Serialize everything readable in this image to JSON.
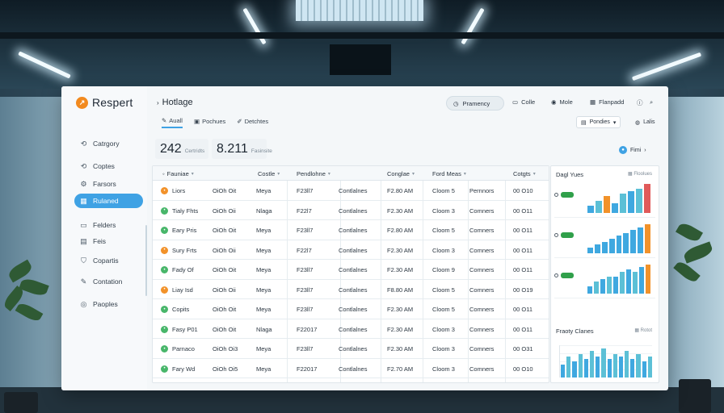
{
  "app": {
    "name": "Respert",
    "breadcrumb": "Hotlage",
    "status_pill": "Pramency",
    "top_buttons": [
      {
        "label": "Colle",
        "icon": "folder-icon"
      },
      {
        "label": "Mole",
        "icon": "circle-icon"
      },
      {
        "label": "Flanpadd",
        "icon": "calendar-icon"
      }
    ],
    "help_icon": "help-icon",
    "search_icon": "search-icon"
  },
  "sidebar": {
    "items": [
      {
        "label": "Catrgory",
        "icon": "refresh-icon",
        "active": false
      },
      {
        "label": "Coptes",
        "icon": "refresh-icon",
        "active": false
      },
      {
        "label": "Farsors",
        "icon": "gear-icon",
        "active": false
      },
      {
        "label": "Rulaned",
        "icon": "grid-icon",
        "active": true
      },
      {
        "label": "Felders",
        "icon": "folder-icon",
        "active": false
      },
      {
        "label": "Feis",
        "icon": "document-icon",
        "active": false
      },
      {
        "label": "Copartis",
        "icon": "filter-icon",
        "active": false
      },
      {
        "label": "Contation",
        "icon": "pen-icon",
        "active": false
      },
      {
        "label": "Paoples",
        "icon": "settings-icon",
        "active": false
      }
    ]
  },
  "tabs": [
    {
      "label": "Auall",
      "icon": "pen-icon",
      "active": true
    },
    {
      "label": "Pochues",
      "icon": "card-icon",
      "active": false
    },
    {
      "label": "Detchtes",
      "icon": "edit-icon",
      "active": false
    }
  ],
  "controls": {
    "filter_label": "Pondies",
    "sort_label": "Lalis",
    "share_label": "Fimi"
  },
  "stats": [
    {
      "value": "242",
      "label": "Certridts"
    },
    {
      "value": "8.211",
      "label": "Fasinsite"
    }
  ],
  "table": {
    "headers": [
      "Fauniae",
      "Costle",
      "Pendlohne",
      "Conglae",
      "Ford Meas",
      "Cotgts"
    ],
    "rows": [
      {
        "status": "orange",
        "name": "Liors",
        "date": "OiOh Oit",
        "type": "Meya",
        "code": "F23ll7",
        "kind": "Contlalnes",
        "time": "F2.80 AM",
        "group": "Cloom 5",
        "category": "Pernnors",
        "num": "00 O10"
      },
      {
        "status": "green",
        "name": "Tialy Fhts",
        "date": "OiOh Oii",
        "type": "Nlaga",
        "code": "F22l7",
        "kind": "Contlalnes",
        "time": "F2.30 AM",
        "group": "Cloom 3",
        "category": "Comners",
        "num": "00 O11"
      },
      {
        "status": "green",
        "name": "Eary Pris",
        "date": "OiOh Oit",
        "type": "Meya",
        "code": "F23ll7",
        "kind": "Contlalnes",
        "time": "F2.80 AM",
        "group": "Cloom 5",
        "category": "Comners",
        "num": "00 O11"
      },
      {
        "status": "orange",
        "name": "Sury Frts",
        "date": "OiOh Oii",
        "type": "Meya",
        "code": "F22l7",
        "kind": "Contlalnes",
        "time": "F2.30 AM",
        "group": "Cloom 3",
        "category": "Comners",
        "num": "00 O11"
      },
      {
        "status": "green",
        "name": "Fady Of",
        "date": "OiOh Oit",
        "type": "Meya",
        "code": "F23ll7",
        "kind": "Contlalnes",
        "time": "F2.30 AM",
        "group": "Cloom 9",
        "category": "Comners",
        "num": "00 O11"
      },
      {
        "status": "orange",
        "name": "Liay Isd",
        "date": "OiOh Oii",
        "type": "Meya",
        "code": "F23ll7",
        "kind": "Contlalnes",
        "time": "F8.80 AM",
        "group": "Cloom 5",
        "category": "Comners",
        "num": "00 O19"
      },
      {
        "status": "green",
        "name": "Copits",
        "date": "OiOh Oit",
        "type": "Meya",
        "code": "F23ll7",
        "kind": "Contlalnes",
        "time": "F2.30 AM",
        "group": "Cloom 5",
        "category": "Comners",
        "num": "00 O11"
      },
      {
        "status": "green",
        "name": "Fasy P01",
        "date": "OiOh Oit",
        "type": "Nlaga",
        "code": "F22017",
        "kind": "Contlalnes",
        "time": "F2.30 AM",
        "group": "Cloom 3",
        "category": "Comners",
        "num": "00 O11"
      },
      {
        "status": "green",
        "name": "Parnaco",
        "date": "OiOh Oi3",
        "type": "Meya",
        "code": "F23ll7",
        "kind": "Contlalnes",
        "time": "F2.30 AM",
        "group": "Cloom 3",
        "category": "Comners",
        "num": "00 O31"
      },
      {
        "status": "green",
        "name": "Fary Wd",
        "date": "OiOh Oi5",
        "type": "Meya",
        "code": "F22017",
        "kind": "Contlalnes",
        "time": "F2.70 AM",
        "group": "Cloom 3",
        "category": "Comners",
        "num": "00 O10"
      }
    ]
  },
  "side_panel": {
    "title": "Dagl Yues",
    "control": "Floolues",
    "badge_color": "#30a04a",
    "trend_title": "Fraoty Clanes",
    "trend_control": "Rotot",
    "colors": {
      "blue": "#3fa8e0",
      "teal": "#5cc0d6",
      "orange": "#f2922a",
      "red": "#e05a5a",
      "green": "#48b66a"
    }
  },
  "chart_data": [
    {
      "type": "bar",
      "values": [
        3,
        5,
        7,
        4,
        8,
        9,
        10,
        12
      ]
    },
    {
      "type": "bar",
      "values": [
        2,
        3,
        4,
        5,
        6,
        7,
        8,
        9,
        10
      ]
    },
    {
      "type": "bar",
      "values": [
        3,
        5,
        6,
        7,
        7,
        9,
        10,
        9,
        11,
        12
      ]
    },
    {
      "type": "bar",
      "values": [
        5,
        8,
        6,
        9,
        7,
        10,
        8,
        11,
        7,
        9,
        8,
        10,
        7,
        9,
        6,
        8
      ]
    }
  ]
}
